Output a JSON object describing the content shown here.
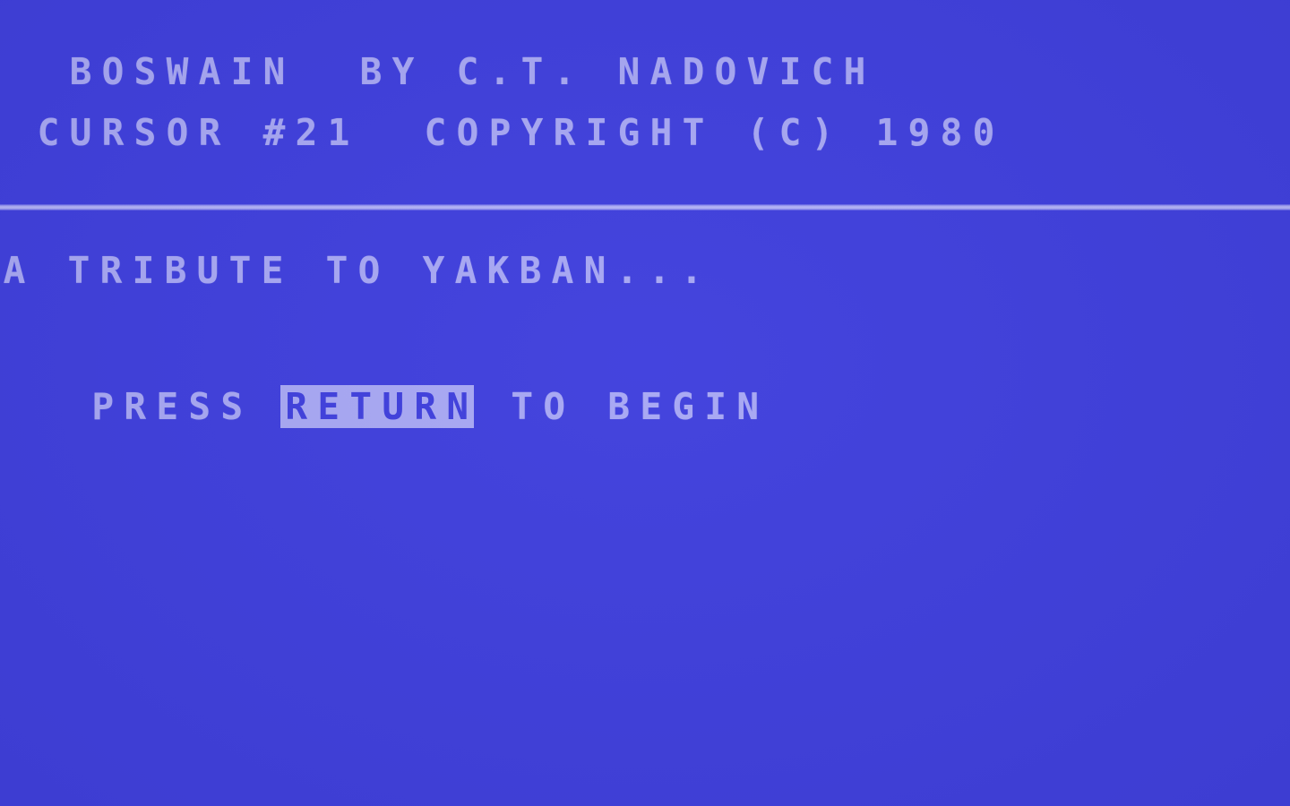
{
  "screen": {
    "columns": 40,
    "rows": 25,
    "background_color": "#4040dd",
    "text_color": "#a8a8f4",
    "border_color": "#4040dd",
    "divider_color": "#a8a8f4"
  },
  "header": {
    "title_line": "  BOSWAIN  BY C.T. NADOVICH",
    "title_game": "BOSWAIN",
    "title_author": "BY C.T. NADOVICH",
    "copyright_line": " CURSOR #21  COPYRIGHT (C) 1980",
    "magazine": "CURSOR #21",
    "copyright": "COPYRIGHT (C) 1980"
  },
  "body": {
    "tribute_line": "A TRIBUTE TO YAKBAN...",
    "prompt_prefix": "PRESS ",
    "prompt_key": "RETURN",
    "prompt_suffix": " TO BEGIN"
  }
}
